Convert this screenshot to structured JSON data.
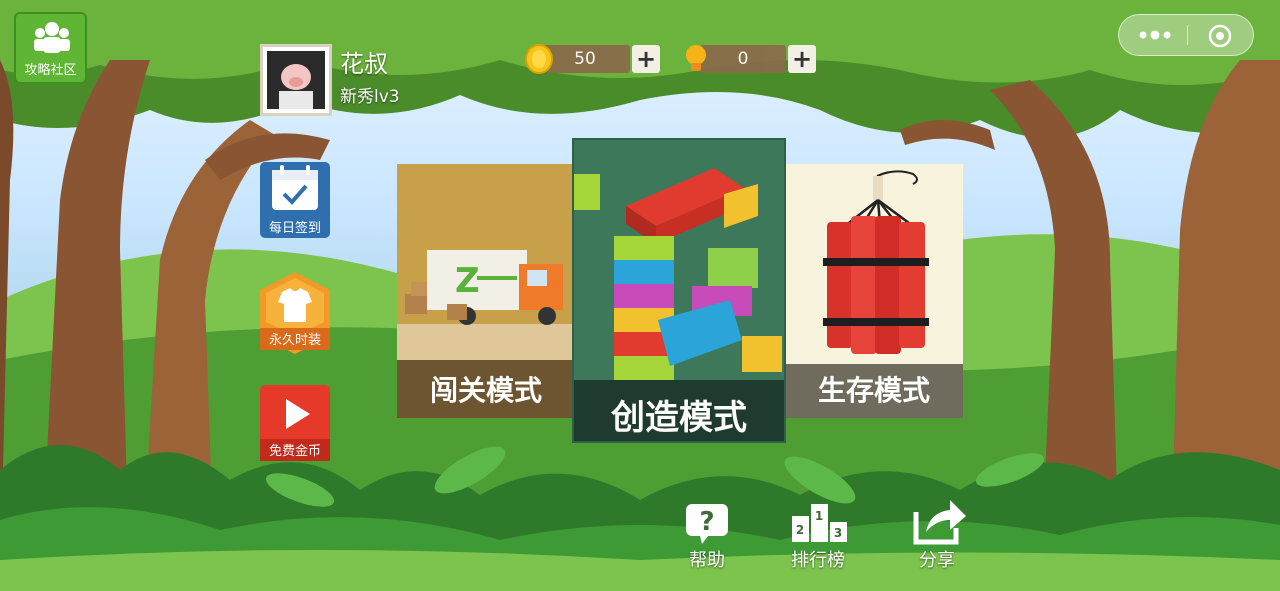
{
  "community": {
    "label": "攻略社区",
    "icon": "people-icon"
  },
  "profile": {
    "name": "花叔",
    "level": "新秀lv3"
  },
  "currency": {
    "coins": {
      "value": "50",
      "icon": "coin-icon"
    },
    "hints": {
      "value": "0",
      "icon": "lightbulb-icon"
    }
  },
  "side_buttons": [
    {
      "label": "每日签到",
      "icon": "calendar-check-icon"
    },
    {
      "label": "永久时装",
      "icon": "shirt-icon"
    },
    {
      "label": "免费金币",
      "icon": "play-video-icon"
    }
  ],
  "modes": [
    {
      "label": "闯关模式",
      "icon": "truck-icon"
    },
    {
      "label": "创造模式",
      "icon": "blocks-icon"
    },
    {
      "label": "生存模式",
      "icon": "dynamite-icon"
    }
  ],
  "nav": [
    {
      "label": "帮助",
      "icon": "help-icon"
    },
    {
      "label": "排行榜",
      "icon": "podium-icon"
    },
    {
      "label": "分享",
      "icon": "share-icon"
    }
  ],
  "podium": {
    "first": "1",
    "second": "2",
    "third": "3"
  },
  "colors": {
    "accent_green": "#5fb534",
    "coin": "#f5c518",
    "card_center": "#3f7a5c"
  }
}
